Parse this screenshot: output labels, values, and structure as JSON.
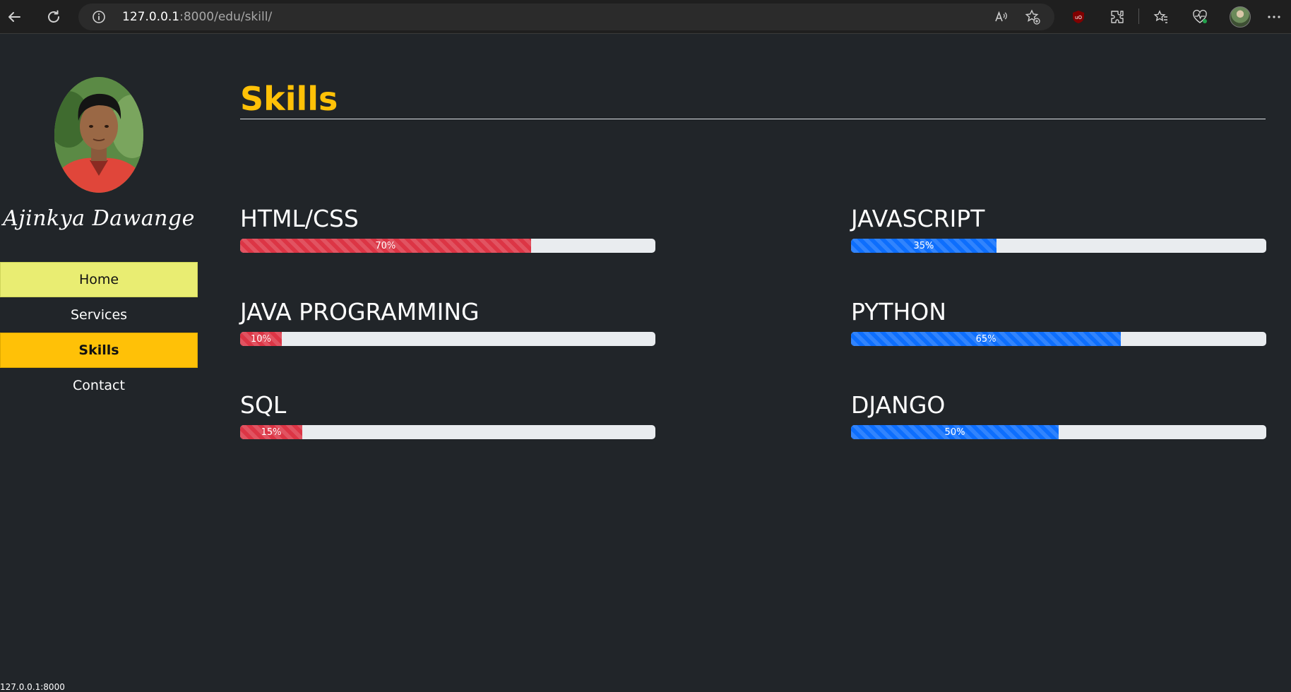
{
  "browser": {
    "url_host": "127.0.0.1",
    "url_path": ":8000/edu/skill/"
  },
  "sidebar": {
    "name": "Ajinkya Dawange",
    "nav": [
      {
        "label": "Home"
      },
      {
        "label": "Services"
      },
      {
        "label": "Skills"
      },
      {
        "label": "Contact"
      }
    ]
  },
  "main": {
    "title": "Skills",
    "skills": [
      {
        "name": "HTML/CSS",
        "percent": 70,
        "label": "70%",
        "color": "#dc3545"
      },
      {
        "name": "JAVASCRIPT",
        "percent": 35,
        "label": "35%",
        "color": "#0d6efd"
      },
      {
        "name": "JAVA PROGRAMMING",
        "percent": 10,
        "label": "10%",
        "color": "#dc3545"
      },
      {
        "name": "PYTHON",
        "percent": 65,
        "label": "65%",
        "color": "#0d6efd"
      },
      {
        "name": "SQL",
        "percent": 15,
        "label": "15%",
        "color": "#dc3545"
      },
      {
        "name": "DJANGO",
        "percent": 50,
        "label": "50%",
        "color": "#0d6efd"
      }
    ]
  },
  "status_bar": {
    "text": "127.0.0.1:8000"
  },
  "colors": {
    "page_bg": "#212529",
    "accent": "#ffc107",
    "home_highlight": "#e9ed72"
  }
}
